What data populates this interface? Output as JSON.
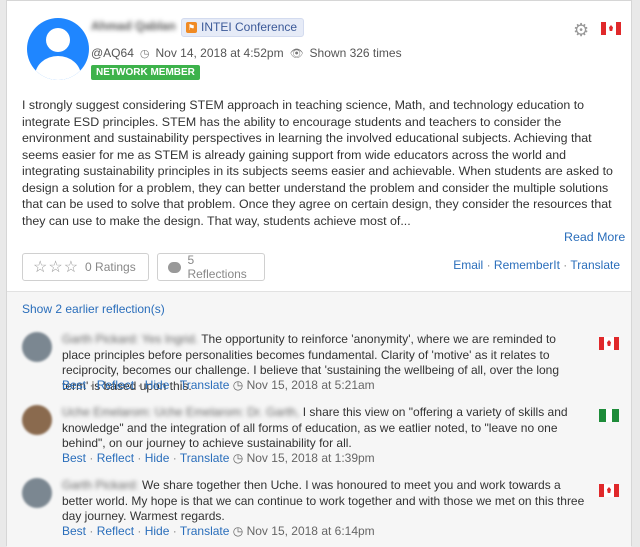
{
  "post": {
    "author": "Ahmad Qablan",
    "conference": "INTEI Conference",
    "handle": "@AQ64",
    "date": "Nov 14, 2018 at 4:52pm",
    "shown": "Shown 326 times",
    "member_badge": "NETWORK MEMBER",
    "body": "I strongly suggest considering STEM approach in teaching science, Math, and technology education to integrate ESD principles. STEM has the ability to encourage students and teachers to consider the environment and sustainability perspectives in learning the involved educational subjects. Achieving that seems easier for me as STEM is already gaining support from wide educators across the world and integrating sustainability principles in its subjects seems easier and achievable. When students are asked to design a solution for a problem, they can better understand the problem and consider the multiple solutions that can be used to solve that problem. Once they agree on certain design, they consider the resources that they can use to make the design. That way, students achieve most of...",
    "read_more": "Read More",
    "ratings": "0 Ratings",
    "reflections": "5 Reflections",
    "links": [
      "Email",
      "RememberIt",
      "Translate"
    ]
  },
  "reflections": {
    "show_earlier": "Show 2 earlier reflection(s)",
    "items": [
      {
        "who": "Garth Pickard: Yes Ingrid.",
        "text": " The opportunity to reinforce 'anonymity', where we are reminded to place principles before personalities becomes fundamental. Clarity of 'motive' as it relates to reciprocity, becomes our challenge. I believe that 'sustaining the wellbeing of all, over the long term' is based upon this.",
        "time": "Nov 15, 2018 at 5:21am",
        "flag": "ca"
      },
      {
        "who": "Uche Emelarom: Uche Emelarom: Dr. Garth,",
        "text": " I share this view on \"offering a variety of skills and knowledge\" and the integration of all forms of education, as we eatlier noted, to \"leave no one behind\", on our journey to achieve sustainability for all.",
        "time": "Nov 15, 2018 at 1:39pm",
        "flag": "ng"
      },
      {
        "who": "Garth Pickard:",
        "text": " We share together then Uche. I was honoured to meet you and work towards a better world. My hope is that we can continue to work together and with those we met on this three day journey. Warmest regards.",
        "time": "Nov 15, 2018 at 6:14pm",
        "flag": "ca"
      }
    ],
    "actions": [
      "Best",
      "Reflect",
      "Hide",
      "Translate"
    ]
  },
  "colors": {
    "link": "#2a6ebb",
    "member_badge": "#3db24b",
    "avatar": "#1f86ff"
  },
  "icons": [
    "user-avatar-icon",
    "conference-icon",
    "gear-icon",
    "canada-flag-icon",
    "nigeria-flag-icon",
    "clock-icon",
    "eye-icon",
    "star-icon",
    "comment-icon"
  ]
}
